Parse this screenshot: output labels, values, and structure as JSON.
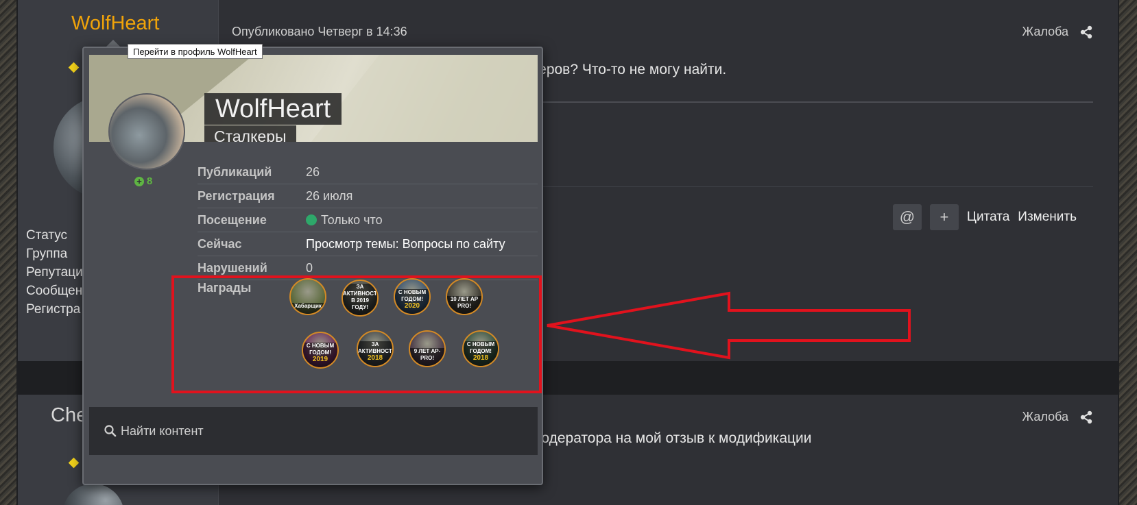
{
  "post1": {
    "author": "WolfHeart",
    "published": "Опубликовано Четверг в 14:36",
    "report": "Жалоба",
    "text": "юзеров? Что-то не могу найти.",
    "stat_labels": [
      "Статус",
      "Группа",
      "Репутаци",
      "Сообщен",
      "Регистра"
    ],
    "actions": {
      "mention": "@",
      "plus": "+",
      "quote": "Цитата",
      "edit": "Изменить"
    }
  },
  "post2": {
    "author": "Che",
    "report": "Жалоба",
    "text": "ия модератора на мой отзыв к модификации"
  },
  "tooltip": "Перейти в профиль WolfHeart",
  "card": {
    "name": "WolfHeart",
    "group": "Сталкеры",
    "reputation": "8",
    "rows": [
      {
        "k": "Публикаций",
        "v": "26"
      },
      {
        "k": "Регистрация",
        "v": "26 июля"
      },
      {
        "k": "Посещение",
        "v": "Только что"
      },
      {
        "k": "Сейчас",
        "v": "Просмотр темы: Вопросы по сайту"
      },
      {
        "k": "Нарушений",
        "v": "0"
      }
    ],
    "awards_label": "Награды",
    "awards": [
      {
        "text": "Хабарщик",
        "year": "",
        "color": "#5d6b3e"
      },
      {
        "text": "ЗА АКТИВНОСТЬ В 2019 ГОДУ!",
        "year": "",
        "color": "#3c3f3c"
      },
      {
        "text": "С НОВЫМ ГОДОМ!",
        "year": "2020",
        "color": "#35506e"
      },
      {
        "text": "10 ЛЕТ AP PRO!",
        "year": "",
        "color": "#3d3a32"
      },
      {
        "text": "С НОВЫМ ГОДОМ!",
        "year": "2019",
        "color": "#6a2a5a"
      },
      {
        "text": "ЗА АКТИВНОСТЬ",
        "year": "2018",
        "color": "#3b4044"
      },
      {
        "text": "9 ЛЕТ AP-PRO!",
        "year": "",
        "color": "#4a3a48"
      },
      {
        "text": "С НОВЫМ ГОДОМ!",
        "year": "2018",
        "color": "#2f4d3a"
      }
    ],
    "search": "Найти контент"
  },
  "colors": {
    "accent": "#f0a30a",
    "highlight": "#e1121d",
    "online": "#2ea86a"
  }
}
